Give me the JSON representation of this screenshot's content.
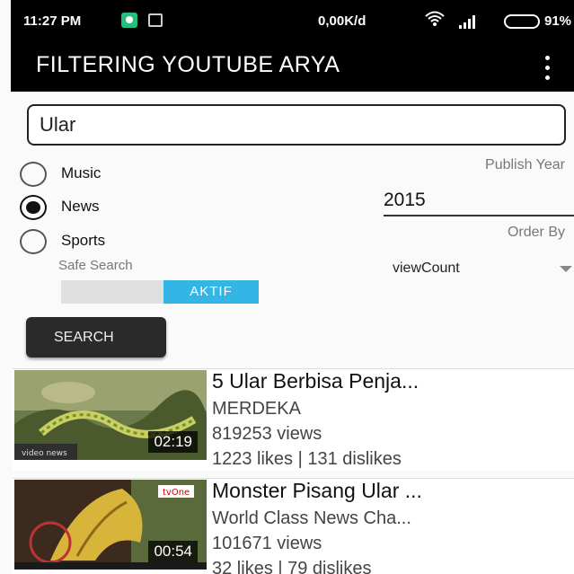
{
  "status_bar": {
    "time": "11:27 PM",
    "speed": "0,00K/d",
    "battery": "91%",
    "icons": [
      "notification-icon",
      "message-icon",
      "wifi-icon",
      "signal-icon",
      "signal-icon",
      "battery-icon"
    ]
  },
  "app_bar": {
    "title": "FILTERING YOUTUBE ARYA",
    "menu_icon": "overflow-menu-icon"
  },
  "search": {
    "value": "Ular"
  },
  "categories": [
    {
      "label": "Music",
      "checked": false
    },
    {
      "label": "News",
      "checked": true
    },
    {
      "label": "Sports",
      "checked": false
    }
  ],
  "filters": {
    "publish_year_label": "Publish Year",
    "publish_year_value": "2015",
    "order_by_label": "Order By",
    "order_by_value": "viewCount",
    "safe_search_label": "Safe Search",
    "safe_search_state": "AKTIF"
  },
  "search_button_label": "SEARCH",
  "videos": [
    {
      "title": "5 Ular Berbisa Penja...",
      "channel": "MERDEKA",
      "views": "819253 views",
      "likes": "1223 likes | 131 dislikes",
      "duration": "02:19"
    },
    {
      "title": "Monster Pisang Ular ...",
      "channel": "World Class News Cha...",
      "views": "101671 views",
      "likes": "32 likes | 79 dislikes",
      "duration": "00:54"
    }
  ],
  "colors": {
    "toggle_accent": "#33b5e5",
    "app_bar": "#000000",
    "button": "#2a2a2a"
  }
}
